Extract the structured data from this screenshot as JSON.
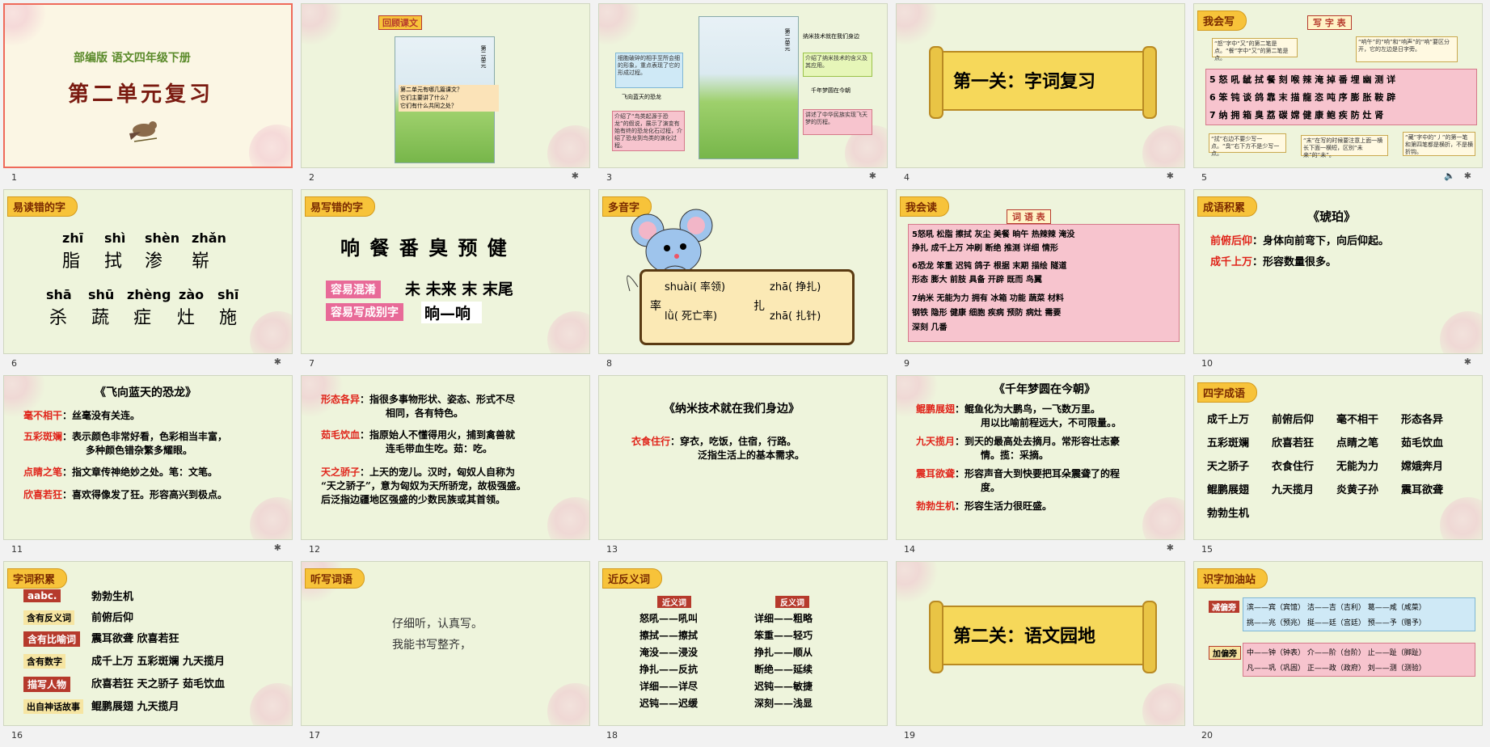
{
  "slides": [
    {
      "n": "1",
      "grade": "部编版 语文四年级下册",
      "title": "第二单元复习"
    },
    {
      "n": "2",
      "tag": "回顾课文",
      "book": "第二单元",
      "q1": "第二单元有哪几篇课文？",
      "q2": "它们主要讲了什么？",
      "q3": "它们有什么共同之处？"
    },
    {
      "n": "3",
      "b1": "细胞破碎的相手至所会细的形象，重点表现了它的形成过程。",
      "b2": "飞向蓝天的恐龙",
      "b3": "介绍了“鸟类起源于恐龙”的假说，展示了演变有始有终的恐龙化石过程，介绍了恐龙到鸟类的演化过程。",
      "b4": "纳米技术就在我们身边",
      "b5": "介绍了纳米技术的含义及其应用。",
      "b6": "千年梦圆在今朝",
      "b7": "讲述了中华民族实现飞天梦的历程。",
      "book": "第二单元"
    },
    {
      "n": "4",
      "scroll": "第一关：字词复习"
    },
    {
      "n": "5",
      "tag": "我会写",
      "head": "写 字 表",
      "rows": [
        "5 怒 吼 龇 拭 餐 刻 喉 辣 淹 掉 番 埋 幽 测 详",
        "6 笨 钝 谈 鸽 靠 末 描 龍 恣 吨 序 膨 胀 鞍 辟",
        "7 纳 拥 箱 臭 荔 碳 嫦 健 康 鲍 疾 防 灶 肾"
      ],
      "c1": "“怒”字中“又”的第二笔是点。“餐”字中“又”的第二笔是点。",
      "c2": "“响午”的“响”和“响声”的“响”要区分开，它的左边是日字旁。",
      "c3": "“拭”右边不要少写一点。“臭”右下方不是少写一点。",
      "c4": "“末”在写的时候要注意上面一横长下面一横短，区别“未来”的“未”。",
      "c5": "“藏”字中的“丿”的第一笔和第四笔都是横折，不是横折钩。"
    },
    {
      "n": "6",
      "tag": "易读错的字",
      "r1p": [
        "zhī",
        "shì",
        "shèn",
        "zhǎn"
      ],
      "r1c": [
        "脂",
        "拭",
        "渗",
        "崭"
      ],
      "r2p": [
        "shā",
        "shū",
        "zhèng",
        "zào",
        "shī"
      ],
      "r2c": [
        "杀",
        "蔬",
        "症",
        "灶",
        "施"
      ]
    },
    {
      "n": "7",
      "tag": "易写错的字",
      "chars": "响 餐 番 臭 预 健",
      "l1": "容易混淆",
      "v1": "未 未来   末 末尾",
      "l2": "容易写成别字",
      "v2": "晌—响"
    },
    {
      "n": "8",
      "tag": "多音字",
      "c1": "率",
      "p1a": "shuài( 率领)",
      "p1b": "lǜ( 死亡率)",
      "c2": "扎",
      "p2a": "zhā( 挣扎)",
      "p2b": "zhā( 扎针)"
    },
    {
      "n": "9",
      "tag": "我会读",
      "head": "词 语 表",
      "l1": "5怒吼  松脂  擦拭  灰尘  美餐  晌午  热辣辣  淹没",
      "l2": "挣扎  成千上万  冲刷  断绝  推测  详细  情形",
      "l3": "6恐龙  笨重  迟钝  鸽子  根据  末期  描绘  隧道",
      "l4": "形态  膨大  前肢  具备  开辟  既而  鸟翼",
      "l5": "7纳米  无能为力  拥有  冰箱  功能  蔬菜  材料",
      "l6": "钢铁  隐形  健康  细胞  疾病  预防  病灶  需要",
      "l7": "深刻  几番"
    },
    {
      "n": "10",
      "tag": "成语积累",
      "title": "《琥珀》",
      "w1": "前俯后仰",
      "d1": "：身体向前弯下，向后仰起。",
      "w2": "成千上万",
      "d2": "：形容数量很多。"
    },
    {
      "n": "11",
      "title": "《飞向蓝天的恐龙》",
      "items": [
        {
          "w": "毫不相干",
          "d": "：丝毫没有关连。"
        },
        {
          "w": "五彩斑斓",
          "d": "：表示颜色非常好看，色彩相当丰富，",
          "d2": "多种颜色错杂繁多耀眼。"
        },
        {
          "w": "点睛之笔",
          "d": "：指文章传神绝妙之处。笔：文笔。"
        },
        {
          "w": "欣喜若狂",
          "d": "：喜欢得像发了狂。形容高兴到极点。"
        }
      ]
    },
    {
      "n": "12",
      "items": [
        {
          "w": "形态各异",
          "d": "：指很多事物形状、姿态、形式不尽",
          "d2": "相同，各有特色。"
        },
        {
          "w": "茹毛饮血",
          "d": "：指原始人不懂得用火，捕到禽兽就",
          "d2": "连毛带血生吃。茹：吃。"
        },
        {
          "w": "天之骄子",
          "d": "：上天的宠儿。汉时，匈奴人自称为",
          "d2": "“天之骄子”，意为匈奴为天所骄宠，故极强盛。",
          "d3": "后泛指边疆地区强盛的少数民族或其首领。"
        }
      ]
    },
    {
      "n": "13",
      "title": "《纳米技术就在我们身边》",
      "w": "衣食住行",
      "d": "：穿衣，吃饭，住宿，行路。",
      "d2": "泛指生活上的基本需求。"
    },
    {
      "n": "14",
      "title": "《千年梦圆在今朝》",
      "items": [
        {
          "w": "鲲鹏展翅",
          "d": "：鲲鱼化为大鹏鸟，一飞数万里。",
          "d2": "用以比喻前程远大，不可限量。。"
        },
        {
          "w": "九天揽月",
          "d": "：到天的最高处去摘月。常形容壮志豪",
          "d2": "情。揽：采摘。"
        },
        {
          "w": "震耳欲聋",
          "d": "：形容声音大到快要把耳朵震聋了的程",
          "d2": "度。"
        },
        {
          "w": "勃勃生机",
          "d": "：形容生活力很旺盛。"
        }
      ]
    },
    {
      "n": "15",
      "tag": "四字成语",
      "rows": [
        [
          "成千上万",
          "前俯后仰",
          "毫不相干",
          "形态各异"
        ],
        [
          "五彩斑斓",
          "欣喜若狂",
          "点睛之笔",
          "茹毛饮血"
        ],
        [
          "天之骄子",
          "衣食住行",
          "无能为力",
          "嫦娥奔月"
        ],
        [
          "鲲鹏展翅",
          "九天揽月",
          "炎黄子孙",
          "震耳欲聋"
        ],
        [
          "勃勃生机"
        ]
      ]
    },
    {
      "n": "16",
      "tag": "字词积累",
      "rows": [
        {
          "l": "aabc.",
          "v": "勃勃生机"
        },
        {
          "l": "含有反义词",
          "v": "前俯后仰"
        },
        {
          "l": "含有比喻词",
          "v": "震耳欲聋   欣喜若狂"
        },
        {
          "l": "含有数字",
          "v": "成千上万   五彩斑斓   九天揽月"
        },
        {
          "l": "描写人物",
          "v": "欣喜若狂   天之骄子   茹毛饮血"
        },
        {
          "l": "出自神话故事",
          "v": "鲲鹏展翅   九天揽月"
        }
      ]
    },
    {
      "n": "17",
      "tag": "听写词语",
      "l1": "仔细听，认真写。",
      "l2": "我能书写整齐，"
    },
    {
      "n": "18",
      "tag": "近反义词",
      "h1": "近义词",
      "h2": "反义词",
      "near": [
        "怒吼——吼叫",
        "擦拭——擦拭",
        "淹没——浸没",
        "挣扎——反抗",
        "详细——详尽",
        "迟钝——迟缓"
      ],
      "anti": [
        "详细——粗略",
        "笨重——轻巧",
        "挣扎——顺从",
        "断绝——延续",
        "迟钝——敏捷",
        "深刻——浅显"
      ]
    },
    {
      "n": "19",
      "scroll": "第二关：语文园地"
    },
    {
      "n": "20",
      "tag": "识字加油站",
      "l1": "减偏旁",
      "r1": "滨——宾（宾馆）   洁——吉（吉利）   葛——咸（咸菜）",
      "r2": "挑——兆（预兆）   挺——廷（宫廷）   预——予（赠予）",
      "l2": "加偏旁",
      "r3": "中——钟（钟表）   介——阶（台阶）   止——趾（脚趾）",
      "r4": "凡——巩（巩固）   正——政（政府）   刘——测（测验）"
    }
  ]
}
